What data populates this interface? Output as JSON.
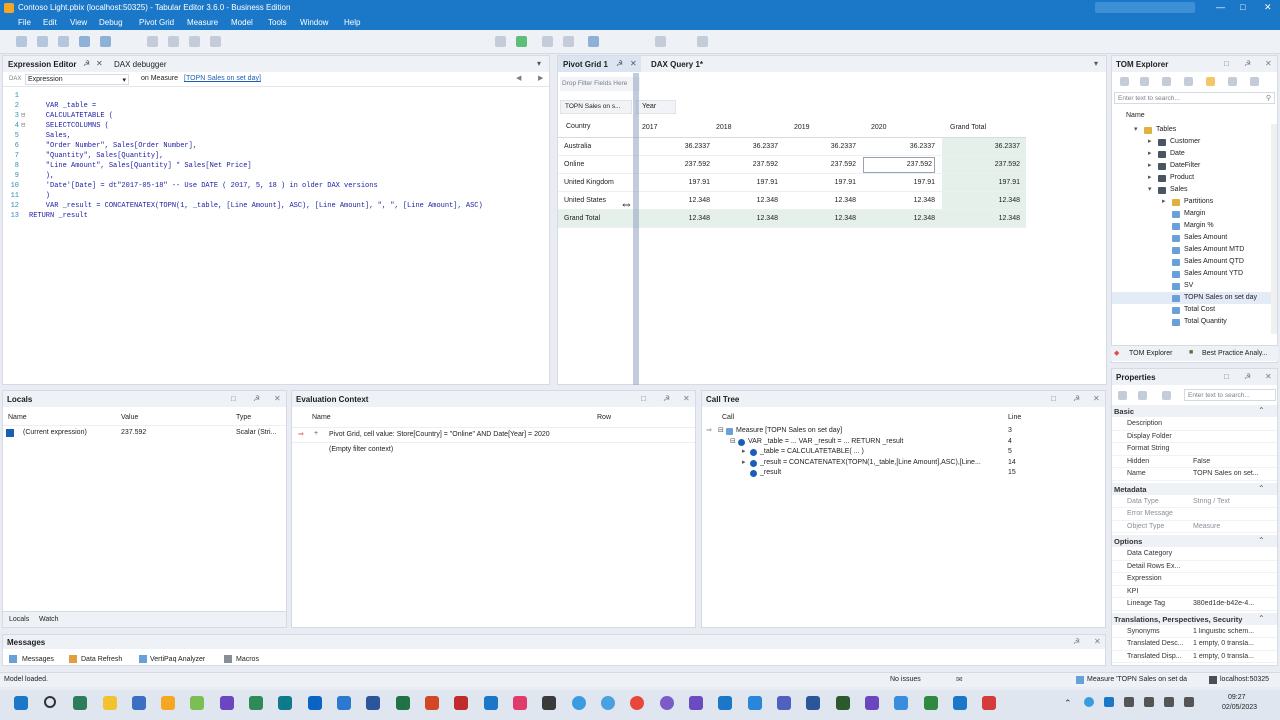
{
  "window": {
    "title": "Contoso Light.pbix (localhost:50325) - Tabular Editor 3.6.0 - Business Edition"
  },
  "menu": [
    "File",
    "Edit",
    "View",
    "Debug",
    "Pivot Grid",
    "Measure",
    "Model",
    "Tools",
    "Window",
    "Help"
  ],
  "expression_editor": {
    "tab": "Expression Editor",
    "tab2": "DAX debugger",
    "dropdown": "Expression",
    "context_prefix": "on Measure",
    "context_link": "[TOPN Sales on set day]",
    "line_numbers": [
      "1",
      "2",
      "3",
      "4",
      "5",
      "6",
      "7",
      "8",
      "9",
      "10",
      "11",
      "12",
      "13"
    ],
    "code": [
      "",
      "    VAR _table =",
      "    CALCULATETABLE (",
      "    SELECTCOLUMNS (",
      "    Sales,",
      "    \"Order Number\", Sales[Order Number],",
      "    \"Quantity\", Sales[Quantity],",
      "    \"Line Amount\", Sales[Quantity] * Sales[Net Price]",
      "    ),",
      "    'Date'[Date] = dt\"2017-05-18\" -- Use DATE ( 2017, 5, 18 ) in older DAX versions",
      "    )",
      "    VAR _result = CONCATENATEX(TOPN(1, _table, [Line Amount], ASC), [Line Amount], \", \", [Line Amount], ASC)",
      "RETURN _result"
    ]
  },
  "pivot": {
    "tab": "Pivot Grid 1",
    "tab2": "DAX Query 1*",
    "drop_filter": "Drop Filter Fields Here",
    "measure_chip": "TOPN Sales on s...",
    "column_chip": "Year",
    "row_header": "Country",
    "columns": [
      "2017",
      "2018",
      "2019",
      "2020",
      "Grand Total"
    ],
    "rows": [
      {
        "label": "Australia",
        "values": [
          "36.2337",
          "36.2337",
          "36.2337",
          "36.2337",
          "36.2337"
        ]
      },
      {
        "label": "Online",
        "values": [
          "237.592",
          "237.592",
          "237.592",
          "237.592",
          "237.592"
        ]
      },
      {
        "label": "United Kingdom",
        "values": [
          "197.91",
          "197.91",
          "197.91",
          "197.91",
          "197.91"
        ]
      },
      {
        "label": "United States",
        "values": [
          "12.348",
          "12.348",
          "12.348",
          "12.348",
          "12.348"
        ]
      },
      {
        "label": "Grand Total",
        "values": [
          "12.348",
          "12.348",
          "12.348",
          "12.348",
          "12.348"
        ]
      }
    ]
  },
  "tom_explorer": {
    "title": "TOM Explorer",
    "search_placeholder": "Enter text to search...",
    "col_header": "Name",
    "items": [
      {
        "label": "Tables",
        "indent": 1,
        "type": "folder"
      },
      {
        "label": "Customer",
        "indent": 2,
        "type": "table"
      },
      {
        "label": "Date",
        "indent": 2,
        "type": "table"
      },
      {
        "label": "DateFilter",
        "indent": 2,
        "type": "table"
      },
      {
        "label": "Product",
        "indent": 2,
        "type": "table"
      },
      {
        "label": "Sales",
        "indent": 2,
        "type": "table"
      },
      {
        "label": "Partitions",
        "indent": 3,
        "type": "folder"
      },
      {
        "label": "Margin",
        "indent": 3,
        "type": "measure"
      },
      {
        "label": "Margin %",
        "indent": 3,
        "type": "measure"
      },
      {
        "label": "Sales Amount",
        "indent": 3,
        "type": "measure"
      },
      {
        "label": "Sales Amount MTD",
        "indent": 3,
        "type": "measure"
      },
      {
        "label": "Sales Amount QTD",
        "indent": 3,
        "type": "measure"
      },
      {
        "label": "Sales Amount YTD",
        "indent": 3,
        "type": "measure"
      },
      {
        "label": "SV",
        "indent": 3,
        "type": "measure"
      },
      {
        "label": "TOPN Sales on set day",
        "indent": 3,
        "type": "measure"
      },
      {
        "label": "Total Cost",
        "indent": 3,
        "type": "measure"
      },
      {
        "label": "Total Quantity",
        "indent": 3,
        "type": "measure"
      }
    ],
    "bottom_tabs": [
      "TOM Explorer",
      "Best Practice Analy..."
    ]
  },
  "properties": {
    "title": "Properties",
    "search_placeholder": "Enter text to search...",
    "sections": [
      {
        "name": "Basic",
        "rows": [
          [
            "Description",
            ""
          ],
          [
            "Display Folder",
            ""
          ],
          [
            "Format String",
            ""
          ],
          [
            "Hidden",
            "False"
          ],
          [
            "Name",
            "TOPN Sales on set..."
          ]
        ]
      },
      {
        "name": "Metadata",
        "rows": [
          [
            "Data Type",
            "String / Text"
          ],
          [
            "Error Message",
            ""
          ],
          [
            "Object Type",
            "Measure"
          ]
        ]
      },
      {
        "name": "Options",
        "rows": [
          [
            "Data Category",
            ""
          ],
          [
            "Detail Rows Ex...",
            ""
          ],
          [
            "Expression",
            ""
          ],
          [
            "KPI",
            ""
          ],
          [
            "Lineage Tag",
            "380ed1de-b42e-4..."
          ]
        ]
      },
      {
        "name": "Translations, Perspectives, Security",
        "rows": [
          [
            "Synonyms",
            "1 linguistic schem..."
          ],
          [
            "Translated Desc...",
            "1 empty, 0 transla..."
          ],
          [
            "Translated Disp...",
            "1 empty, 0 transla..."
          ]
        ]
      }
    ]
  },
  "locals": {
    "title": "Locals",
    "columns": [
      "Name",
      "Value",
      "Type"
    ],
    "row": {
      "name": "(Current expression)",
      "value": "237.592",
      "type": "Scalar (Stri..."
    },
    "tabs": [
      "Locals",
      "Watch"
    ]
  },
  "eval_context": {
    "title": "Evaluation Context",
    "columns": [
      "Name",
      "Row"
    ],
    "rows": [
      "Pivot Grid, cell value: Store[Country] = \"Online\" AND Date[Year] = 2020",
      "(Empty filter context)"
    ]
  },
  "call_tree": {
    "title": "Call Tree",
    "columns": [
      "Call",
      "Line"
    ],
    "rows": [
      {
        "label": "Measure [TOPN Sales on set day]",
        "line": "3",
        "indent": 0
      },
      {
        "label": "VAR _table = ... VAR _result = ... RETURN _result",
        "line": "4",
        "indent": 1
      },
      {
        "label": "_table = CALCULATETABLE( ... )",
        "line": "5",
        "indent": 2
      },
      {
        "label": "_result = CONCATENATEX(TOPN(1,_table,[Line Amount],ASC),[Line...",
        "line": "14",
        "indent": 2
      },
      {
        "label": "_result",
        "line": "15",
        "indent": 2
      }
    ]
  },
  "messages": {
    "title": "Messages",
    "tabs": [
      "Messages",
      "Data Refresh",
      "VertiPaq Analyzer",
      "Macros"
    ]
  },
  "status": {
    "left": "Model loaded.",
    "middle": "No issues",
    "right1": "Measure 'TOPN Sales on set da",
    "right2": "localhost:50325"
  },
  "taskbar": {
    "time": "09:27",
    "date": "02/05/2023"
  },
  "colors": {
    "accent": "#1b78c8",
    "pivot_total": "#e6f0ea"
  }
}
